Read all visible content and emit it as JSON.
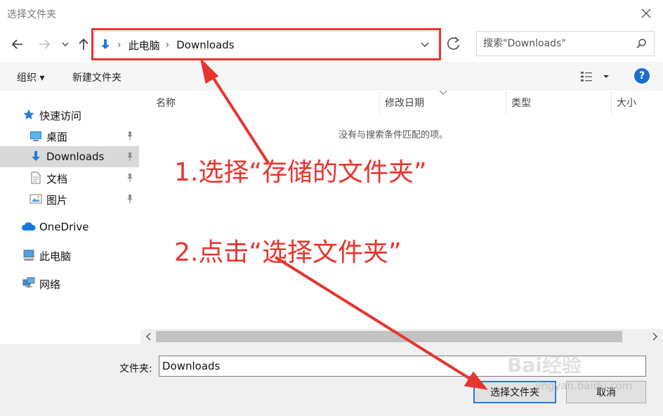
{
  "window": {
    "title": "选择文件夹"
  },
  "address": {
    "crumbs": [
      "此电脑",
      "Downloads"
    ]
  },
  "search": {
    "placeholder": "搜索\"Downloads\""
  },
  "toolbar": {
    "organize": "组织 ▾",
    "new_folder": "新建文件夹",
    "help": "?"
  },
  "sidebar": {
    "quick_access": "快速访问",
    "items": [
      {
        "label": "桌面",
        "icon": "desktop-icon"
      },
      {
        "label": "Downloads",
        "icon": "download-icon",
        "selected": true
      },
      {
        "label": "文档",
        "icon": "document-icon"
      },
      {
        "label": "图片",
        "icon": "picture-icon"
      }
    ],
    "onedrive": "OneDrive",
    "this_pc": "此电脑",
    "network": "网络"
  },
  "columns": {
    "name": "名称",
    "modified": "修改日期",
    "type": "类型",
    "size": "大小"
  },
  "content": {
    "empty_message": "没有与搜索条件匹配的项。"
  },
  "bottom": {
    "folder_label": "文件夹:",
    "folder_value": "Downloads",
    "select_button": "选择文件夹",
    "cancel_button": "取消"
  },
  "annotations": {
    "step1": "1.选择“存储的文件夹”",
    "step2": "2.点击“选择文件夹”",
    "color": "#e8342e"
  },
  "watermark": {
    "brand": "Bai经验",
    "url": "jingyan.baidu.com"
  },
  "colors": {
    "accent": "#1a6fcf",
    "selection": "#d9d9d9"
  }
}
